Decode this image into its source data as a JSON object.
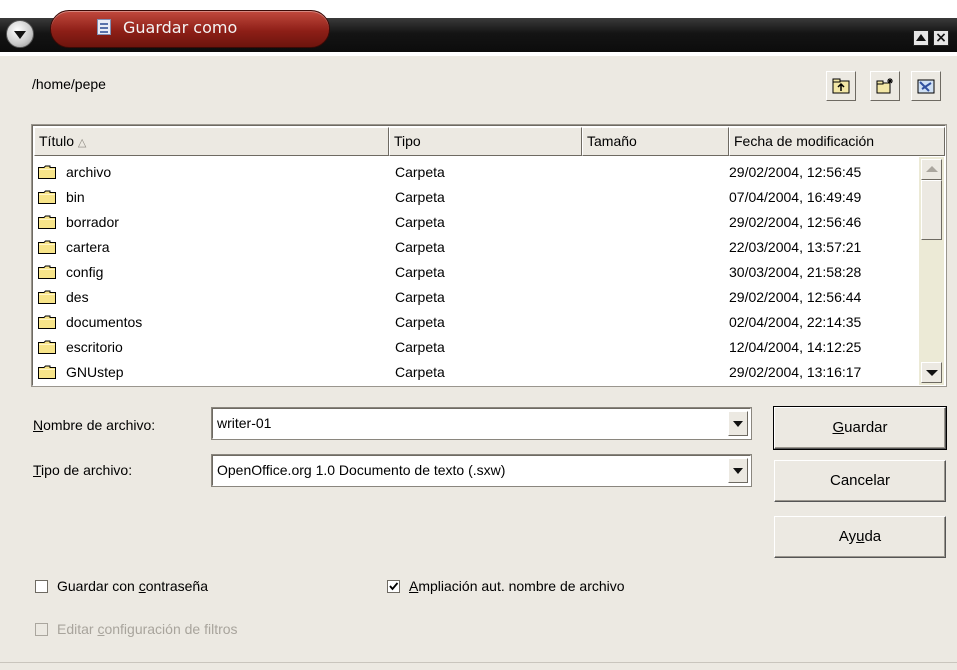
{
  "window": {
    "title": "Guardar como"
  },
  "path": "/home/pepe",
  "toolbar": {
    "up_icon": "folder-up-icon",
    "new_folder_icon": "new-folder-icon",
    "default_dir_icon": "default-directory-icon"
  },
  "filelist": {
    "columns": [
      "Título",
      "Tipo",
      "Tamaño",
      "Fecha de modificación"
    ],
    "sort_indicator": "△",
    "rows": [
      {
        "name": "archivo",
        "type": "Carpeta",
        "size": "",
        "date": "29/02/2004, 12:56:45"
      },
      {
        "name": "bin",
        "type": "Carpeta",
        "size": "",
        "date": "07/04/2004, 16:49:49"
      },
      {
        "name": "borrador",
        "type": "Carpeta",
        "size": "",
        "date": "29/02/2004, 12:56:46"
      },
      {
        "name": "cartera",
        "type": "Carpeta",
        "size": "",
        "date": "22/03/2004, 13:57:21"
      },
      {
        "name": "config",
        "type": "Carpeta",
        "size": "",
        "date": "30/03/2004, 21:58:28"
      },
      {
        "name": "des",
        "type": "Carpeta",
        "size": "",
        "date": "29/02/2004, 12:56:44"
      },
      {
        "name": "documentos",
        "type": "Carpeta",
        "size": "",
        "date": "02/04/2004, 22:14:35"
      },
      {
        "name": "escritorio",
        "type": "Carpeta",
        "size": "",
        "date": "12/04/2004, 14:12:25"
      },
      {
        "name": "GNUstep",
        "type": "Carpeta",
        "size": "",
        "date": "29/02/2004, 13:16:17"
      }
    ]
  },
  "form": {
    "filename_label_u": "N",
    "filename_label_rest": "ombre de archivo:",
    "filename_value": "writer-01",
    "filetype_label_u": "T",
    "filetype_label_rest": "ipo de archivo:",
    "filetype_value": "OpenOffice.org 1.0 Documento de texto (.sxw)"
  },
  "buttons": {
    "save_u": "G",
    "save_rest": "uardar",
    "cancel": "Cancelar",
    "help_pre": "Ay",
    "help_u": "u",
    "help_post": "da"
  },
  "options": {
    "password_pre": "Guardar con ",
    "password_u": "c",
    "password_post": "ontraseña",
    "password_checked": false,
    "ext_u": "A",
    "ext_rest": "mpliación aut. nombre de archivo",
    "ext_checked": true,
    "filter_pre": "Editar ",
    "filter_u": "c",
    "filter_post": "onfiguración de filtros",
    "filter_enabled": false
  }
}
